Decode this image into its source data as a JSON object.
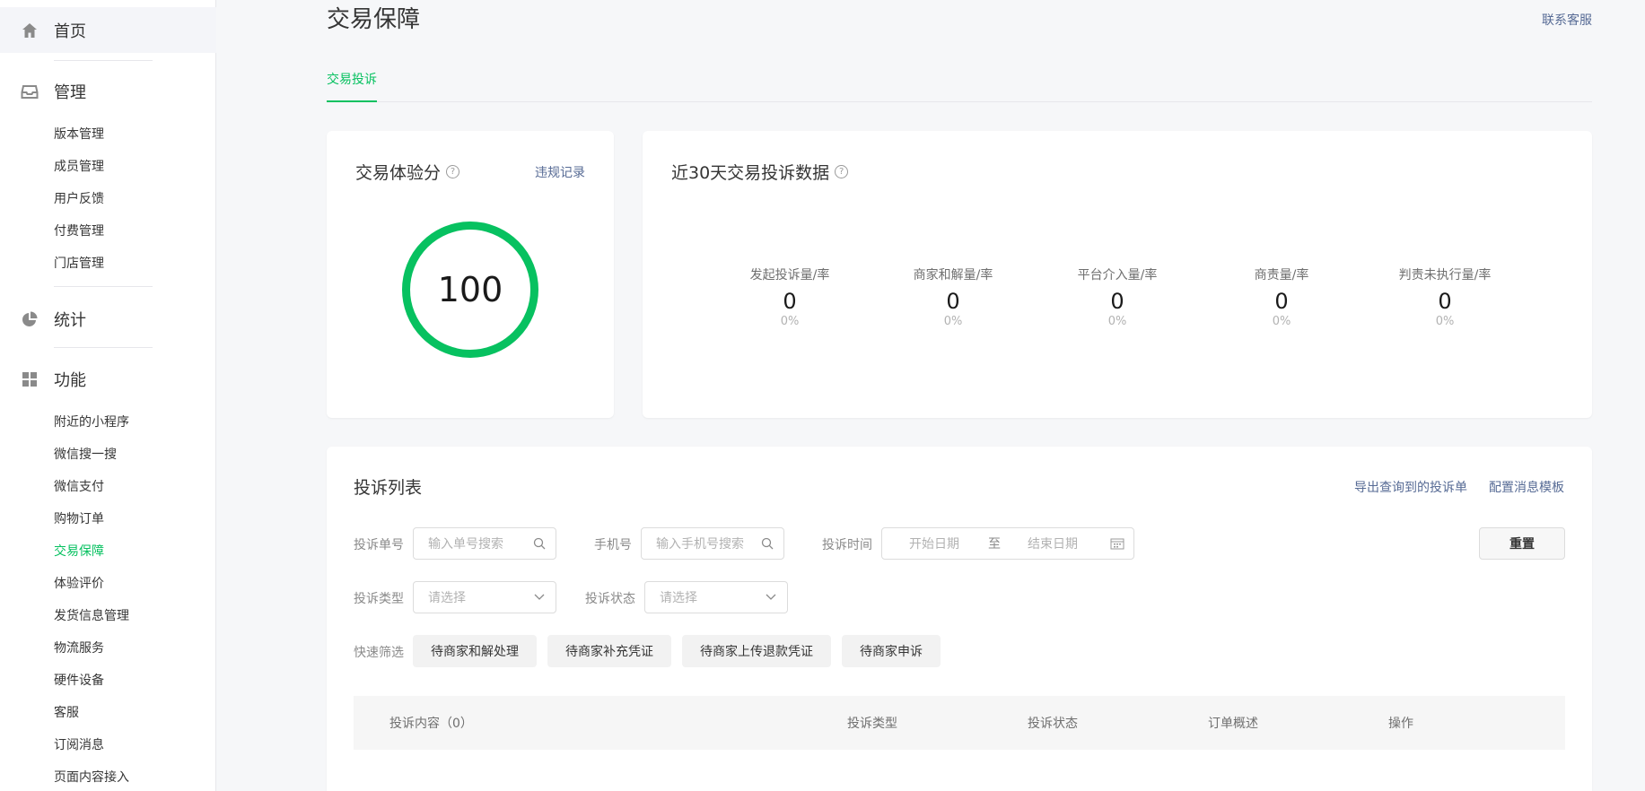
{
  "sidebar": {
    "home": "首页",
    "manage": "管理",
    "manage_items": [
      "版本管理",
      "成员管理",
      "用户反馈",
      "付费管理",
      "门店管理"
    ],
    "stats": "统计",
    "func": "功能",
    "func_items": [
      "附近的小程序",
      "微信搜一搜",
      "微信支付",
      "购物订单",
      "交易保障",
      "体验评价",
      "发货信息管理",
      "物流服务",
      "硬件设备",
      "客服",
      "订阅消息",
      "页面内容接入"
    ]
  },
  "page": {
    "title": "交易保障",
    "contact": "联系客服",
    "tab": "交易投诉"
  },
  "score_card": {
    "title": "交易体验分",
    "help": "?",
    "link": "违规记录",
    "score": "100"
  },
  "stats_card": {
    "title": "近30天交易投诉数据",
    "help": "?",
    "items": [
      {
        "label": "发起投诉量/率",
        "count": "0",
        "pct": "0%"
      },
      {
        "label": "商家和解量/率",
        "count": "0",
        "pct": "0%"
      },
      {
        "label": "平台介入量/率",
        "count": "0",
        "pct": "0%"
      },
      {
        "label": "商责量/率",
        "count": "0",
        "pct": "0%"
      },
      {
        "label": "判责未执行量/率",
        "count": "0",
        "pct": "0%"
      }
    ]
  },
  "list_card": {
    "title": "投诉列表",
    "export": "导出查询到的投诉单",
    "config": "配置消息模板",
    "filters": {
      "order_label": "投诉单号",
      "order_placeholder": "输入单号搜索",
      "phone_label": "手机号",
      "phone_placeholder": "输入手机号搜索",
      "time_label": "投诉时间",
      "start_date": "开始日期",
      "to": "至",
      "end_date": "结束日期",
      "reset": "重置",
      "type_label": "投诉类型",
      "type_placeholder": "请选择",
      "status_label": "投诉状态",
      "status_placeholder": "请选择",
      "quick_label": "快速筛选",
      "quick": [
        "待商家和解处理",
        "待商家补充凭证",
        "待商家上传退款凭证",
        "待商家申诉"
      ]
    },
    "columns": [
      "投诉内容（0）",
      "投诉类型",
      "投诉状态",
      "订单概述",
      "操作"
    ]
  },
  "colors": {
    "accent": "#07c160",
    "link": "#576b95"
  }
}
